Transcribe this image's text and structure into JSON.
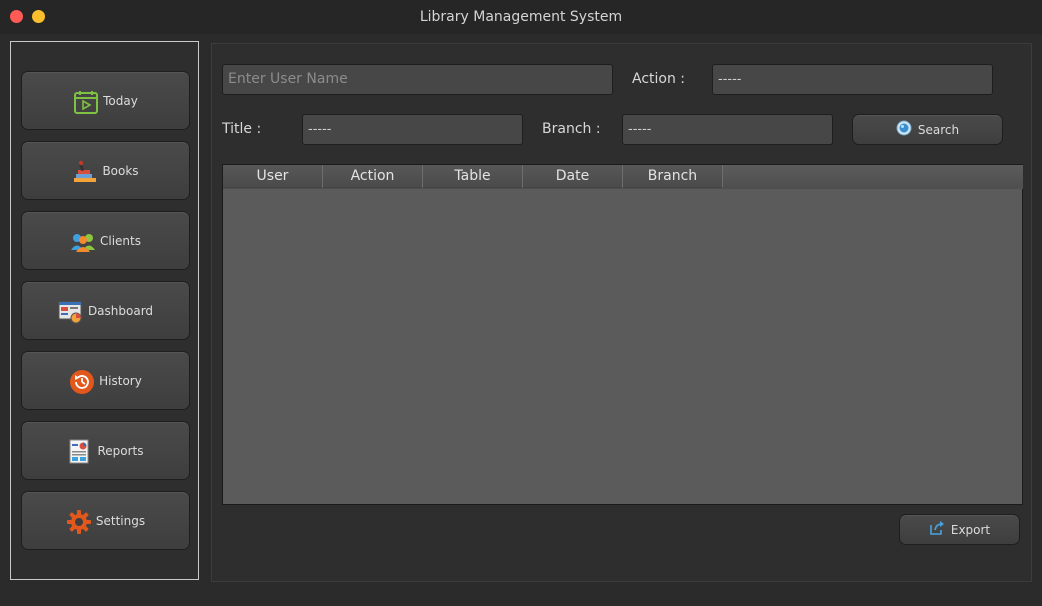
{
  "window": {
    "title": "Library Management System"
  },
  "sidebar": {
    "items": [
      {
        "label": "Today",
        "icon": "calendar-icon"
      },
      {
        "label": "Books",
        "icon": "books-icon"
      },
      {
        "label": "Clients",
        "icon": "clients-icon"
      },
      {
        "label": "Dashboard",
        "icon": "dashboard-icon"
      },
      {
        "label": "History",
        "icon": "history-icon"
      },
      {
        "label": "Reports",
        "icon": "reports-icon"
      },
      {
        "label": "Settings",
        "icon": "gear-icon"
      }
    ]
  },
  "filters": {
    "user_placeholder": "Enter User Name",
    "action_label": "Action :",
    "action_value": "-----",
    "title_label": "Title :",
    "title_value": "-----",
    "branch_label": "Branch :",
    "branch_value": "-----",
    "search_label": "Search"
  },
  "table": {
    "columns": [
      "User",
      "Action",
      "Table",
      "Date",
      "Branch"
    ],
    "rows": []
  },
  "export_label": "Export",
  "colors": {
    "background": "#2b2b2b",
    "field": "#474747",
    "table_body": "#5b5b5b",
    "close_dot": "#ff5b56",
    "minimize_dot": "#fbbe2c"
  }
}
